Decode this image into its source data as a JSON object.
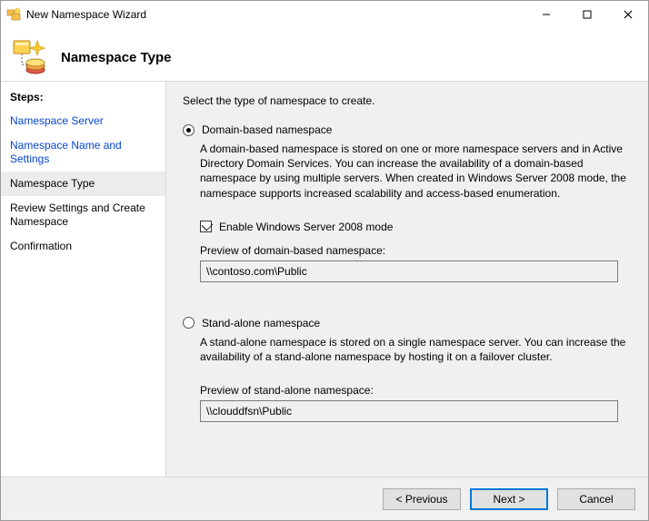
{
  "window": {
    "title": "New Namespace Wizard"
  },
  "header": {
    "title": "Namespace Type"
  },
  "sidebar": {
    "heading": "Steps:",
    "items": [
      {
        "label": "Namespace Server",
        "kind": "link"
      },
      {
        "label": "Namespace Name and Settings",
        "kind": "link"
      },
      {
        "label": "Namespace Type",
        "kind": "current"
      },
      {
        "label": "Review Settings and Create Namespace",
        "kind": "normal"
      },
      {
        "label": "Confirmation",
        "kind": "normal"
      }
    ]
  },
  "main": {
    "instruction": "Select the type of namespace to create.",
    "option1": {
      "label": "Domain-based namespace",
      "desc": "A domain-based namespace is stored on one or more namespace servers and in Active Directory Domain Services. You can increase the availability of a domain-based namespace by using multiple servers. When created in Windows Server 2008 mode, the namespace supports increased scalability and access-based enumeration.",
      "checkbox_label": "Enable Windows Server 2008 mode",
      "preview_label": "Preview of domain-based namespace:",
      "preview_value": "\\\\contoso.com\\Public"
    },
    "option2": {
      "label": "Stand-alone namespace",
      "desc": "A stand-alone namespace is stored on a single namespace server. You can increase the availability of a stand-alone namespace by hosting it on a failover cluster.",
      "preview_label": "Preview of stand-alone namespace:",
      "preview_value": "\\\\clouddfsn\\Public"
    }
  },
  "footer": {
    "previous": "< Previous",
    "next": "Next >",
    "cancel": "Cancel"
  }
}
